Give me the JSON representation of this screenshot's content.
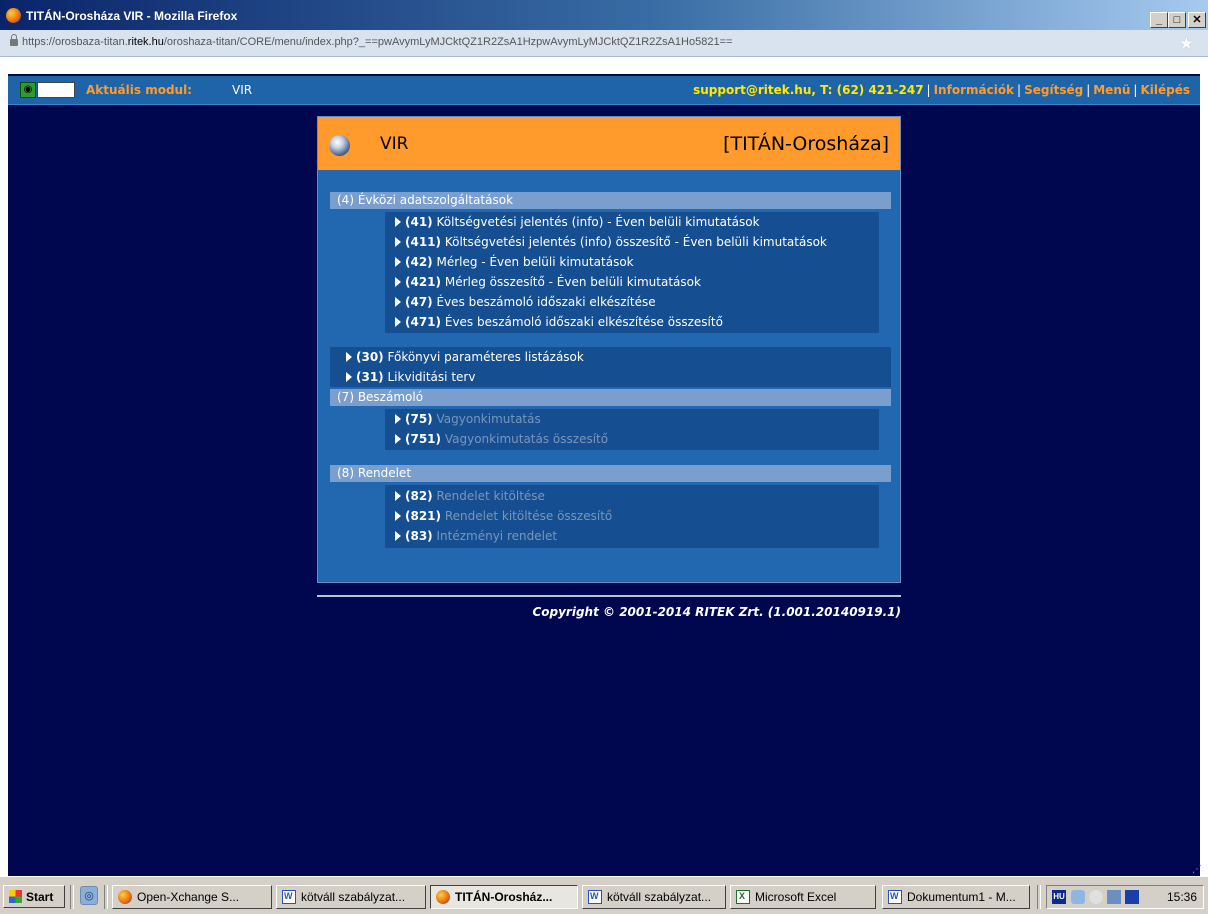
{
  "window": {
    "title": "TITÁN-Orosháza VIR - Mozilla Firefox",
    "minimize": "_",
    "maximize": "□",
    "close": "✕"
  },
  "browser": {
    "url_prefix": "https://orosbaza-titan.",
    "url_domain": "ritek.hu",
    "url_suffix": "/oroshaza-titan/CORE/menu/index.php?_==pwAvymLyMJCktQZ1R2ZsA1HzpwAvymLyMJCktQZ1R2ZsA1Ho5821==",
    "bookmark_icon": "star-icon"
  },
  "topbar": {
    "module_label": "Aktuális modul:",
    "module_value": "VIR",
    "support": "support@ritek.hu, T: (62) 421-247",
    "separator": "|",
    "links": [
      "Információk",
      "Segítség",
      "Menü",
      "Kilépés"
    ]
  },
  "panel": {
    "title": "VIR",
    "org": "[TITÁN-Orosháza]",
    "sections": [
      {
        "title": "(4) Évközi adatszolgáltatások",
        "items": [
          {
            "code": "(41)",
            "label": "Költségvetési jelentés (info) - Éven belüli kimutatások",
            "enabled": true
          },
          {
            "code": "(411)",
            "label": "Költségvetési jelentés (info) összesítő - Éven belüli kimutatások",
            "enabled": true
          },
          {
            "code": "(42)",
            "label": "Mérleg - Éven belüli kimutatások",
            "enabled": true
          },
          {
            "code": "(421)",
            "label": "Mérleg összesítő - Éven belüli kimutatások",
            "enabled": true
          },
          {
            "code": "(47)",
            "label": "Éves beszámoló időszaki elkészítése",
            "enabled": true
          },
          {
            "code": "(471)",
            "label": "Éves beszámoló időszaki elkészítése összesítő",
            "enabled": true
          }
        ]
      },
      {
        "title": "",
        "items": [
          {
            "code": "(30)",
            "label": "Főkönyvi paraméteres listázások",
            "enabled": true
          },
          {
            "code": "(31)",
            "label": "Likviditási terv",
            "enabled": true
          }
        ]
      },
      {
        "title": "(7) Beszámoló",
        "items": [
          {
            "code": "(75)",
            "label": "Vagyonkimutatás",
            "enabled": false
          },
          {
            "code": "(751)",
            "label": "Vagyonkimutatás összesítő",
            "enabled": false
          }
        ]
      },
      {
        "title": "(8) Rendelet",
        "items": [
          {
            "code": "(82)",
            "label": "Rendelet kitöltése",
            "enabled": false
          },
          {
            "code": "(821)",
            "label": "Rendelet kitöltése összesítő",
            "enabled": false
          },
          {
            "code": "(83)",
            "label": "Intézményi rendelet",
            "enabled": false
          }
        ]
      }
    ]
  },
  "footer": {
    "copyright": "Copyright © 2001-2014 RITEK Zrt. (1.001.20140919.1)"
  },
  "taskbar": {
    "start": "Start",
    "buttons": [
      {
        "label": "Open-Xchange S...",
        "icon": "firefox-icon",
        "active": false
      },
      {
        "label": "kötváll szabályzat...",
        "icon": "word-document-icon",
        "active": false
      },
      {
        "label": "TITÁN-Orosház...",
        "icon": "firefox-icon",
        "active": true
      },
      {
        "label": "kötváll szabályzat...",
        "icon": "word-document-icon",
        "active": false
      },
      {
        "label": "Microsoft Excel",
        "icon": "excel-icon",
        "active": false
      },
      {
        "label": "Dokumentum1 - M...",
        "icon": "word-document-icon",
        "active": false
      }
    ],
    "language": "HU",
    "clock": "15:36"
  },
  "colors": {
    "page_bg": "#00074e",
    "topbar_bg": "#1f64a8",
    "panel_header": "#ff9a2c",
    "panel_bg": "#2268b0",
    "section_header": "#7a9fcf",
    "submenu_bg": "#154f92",
    "accent_orange": "#ff9c2a",
    "support_yellow": "#ffea00",
    "disabled_text": "#7a96b8"
  }
}
